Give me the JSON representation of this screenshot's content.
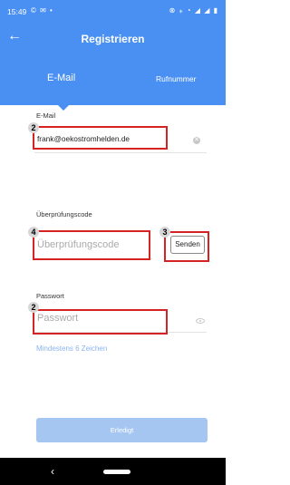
{
  "status_bar": {
    "time": "15:49",
    "left_icons": "© ✉ •",
    "right_icons": "⊗ ⁎ ◔ ◢ ◢ ▮"
  },
  "header": {
    "back_glyph": "←",
    "title": "Registrieren",
    "tabs": [
      {
        "label": "E-Mail",
        "active": true
      },
      {
        "label": "Rufnummer",
        "active": false
      }
    ]
  },
  "form": {
    "email": {
      "label": "E-Mail",
      "value": "frank@oekostromhelden.de",
      "clear_glyph": "✕"
    },
    "code": {
      "label": "Überprüfungscode",
      "placeholder": "Überprüfungscode",
      "send_label": "Senden"
    },
    "password": {
      "label": "Passwort",
      "placeholder": "Passwort",
      "hint": "Mindestens 6 Zeichen"
    }
  },
  "annotations": [
    "2",
    "4",
    "3",
    "2"
  ],
  "done_label": "Erledigt",
  "nav_bar": {
    "back_glyph": "‹"
  },
  "colors": {
    "accent": "#4a90f2",
    "highlight_box": "#d52222"
  }
}
